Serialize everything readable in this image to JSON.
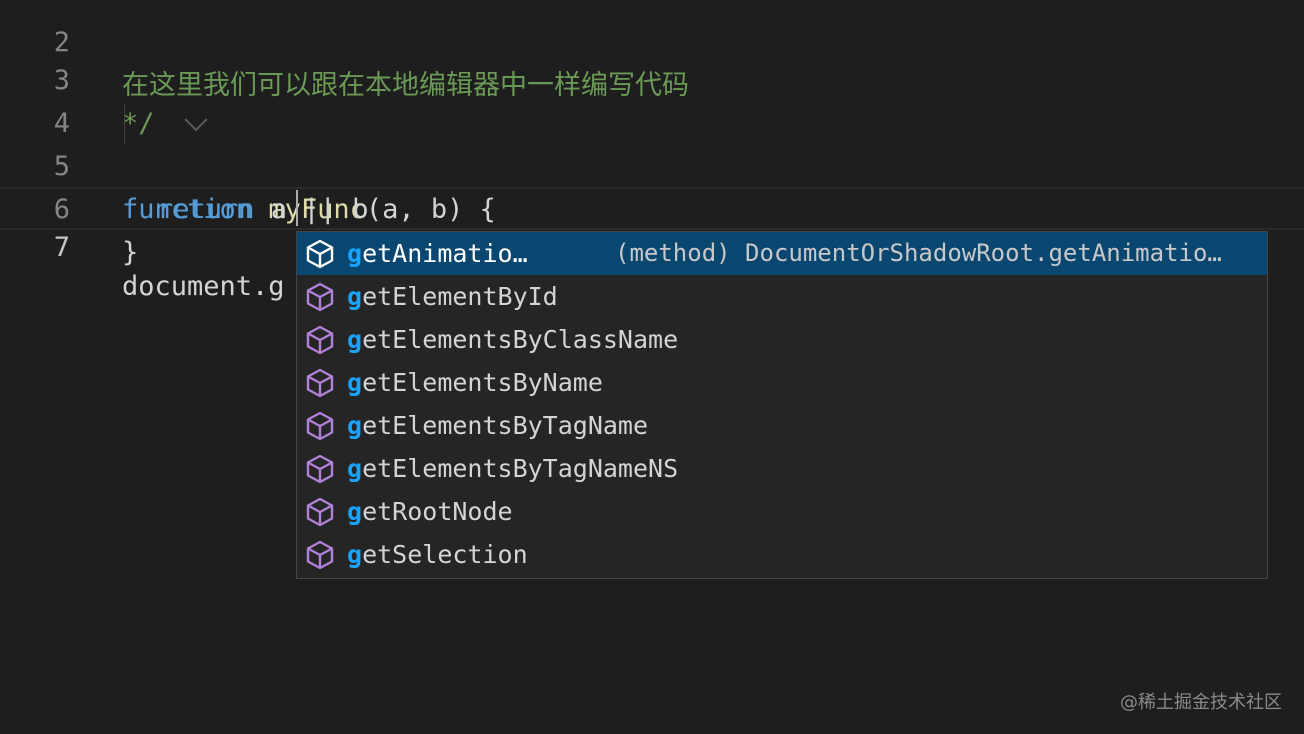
{
  "editor": {
    "lines": [
      {
        "number": "2",
        "text": "在这里我们可以跟在本地编辑器中一样编写代码"
      },
      {
        "number": "3",
        "text": "*/"
      },
      {
        "number": "4",
        "keyword": "function",
        "fn": "myFunc",
        "rest": "(a, b) {"
      },
      {
        "number": "5",
        "keyword": "return",
        "rest": " a || b"
      },
      {
        "number": "6",
        "text": "}"
      },
      {
        "number": "7",
        "text": "document.g"
      }
    ]
  },
  "suggest": {
    "match_prefix": "g",
    "items": [
      {
        "rest": "etAnimatio…",
        "detail": "(method) DocumentOrShadowRoot.getAnimatio…",
        "selected": true
      },
      {
        "rest": "etElementById"
      },
      {
        "rest": "etElementsByClassName"
      },
      {
        "rest": "etElementsByName"
      },
      {
        "rest": "etElementsByTagName"
      },
      {
        "rest": "etElementsByTagNameNS"
      },
      {
        "rest": "etRootNode"
      },
      {
        "rest": "etSelection"
      }
    ],
    "icon": "method-cube-icon",
    "colors": {
      "icon_selected": "#ffffff",
      "icon": "#b180d7",
      "match": "#18a3ff",
      "selected_bg": "#094771"
    }
  },
  "watermark": "@稀土掘金技术社区"
}
